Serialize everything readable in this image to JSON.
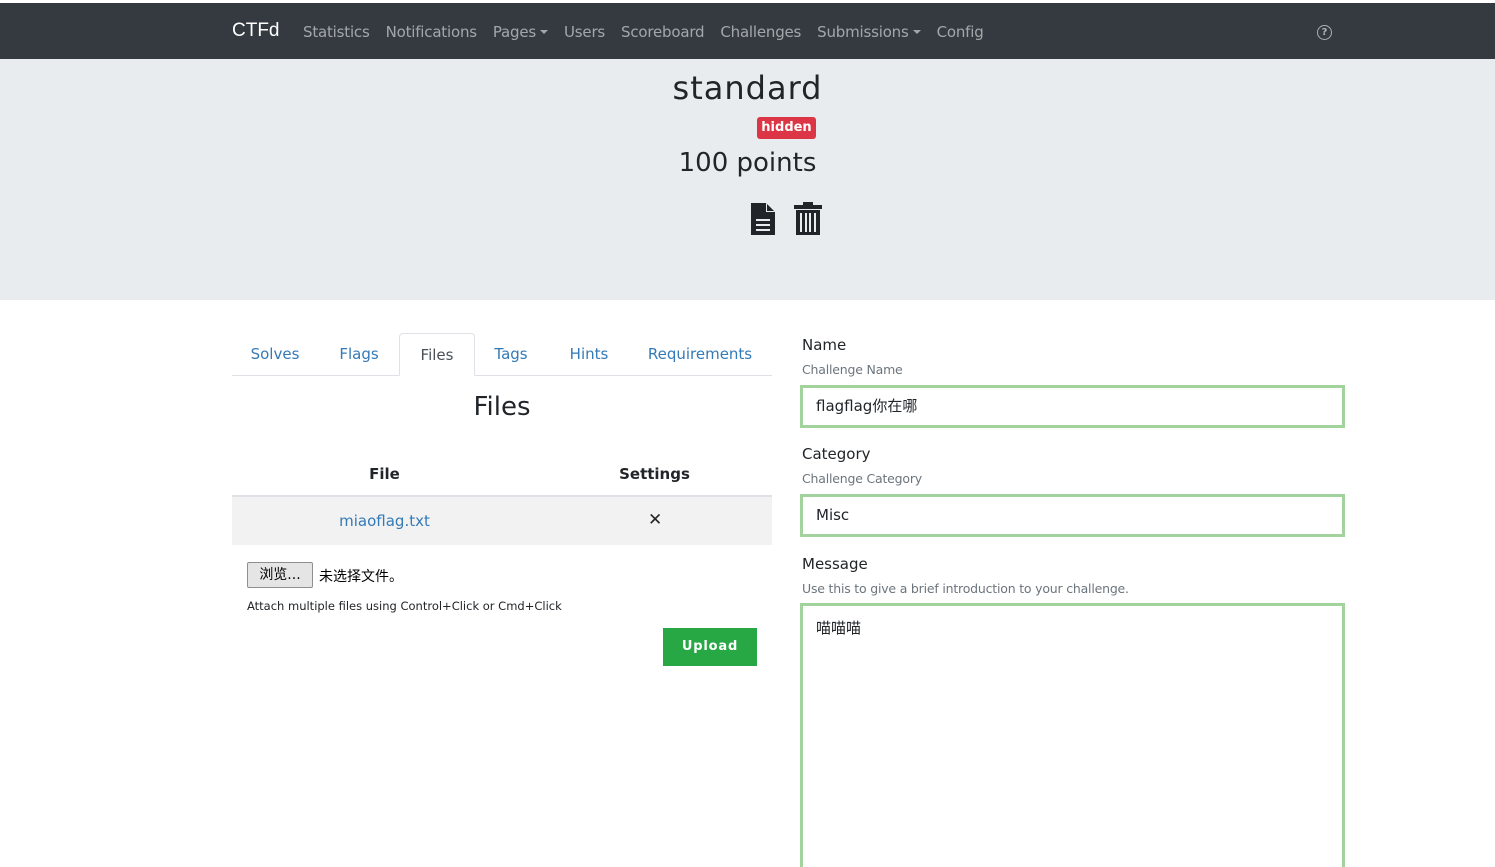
{
  "navbar": {
    "brand": "CTFd",
    "items": [
      {
        "label": "Statistics",
        "dropdown": false
      },
      {
        "label": "Notifications",
        "dropdown": false
      },
      {
        "label": "Pages",
        "dropdown": true
      },
      {
        "label": "Users",
        "dropdown": false
      },
      {
        "label": "Scoreboard",
        "dropdown": false
      },
      {
        "label": "Challenges",
        "dropdown": false
      },
      {
        "label": "Submissions",
        "dropdown": true
      },
      {
        "label": "Config",
        "dropdown": false
      }
    ],
    "help_icon": "question-circle-icon"
  },
  "challenge": {
    "title": "standard",
    "badge": "hidden",
    "points": "100 points",
    "icons": [
      "file-text-icon",
      "trash-icon"
    ]
  },
  "tabs": [
    {
      "label": "Solves",
      "active": false
    },
    {
      "label": "Flags",
      "active": false
    },
    {
      "label": "Files",
      "active": true
    },
    {
      "label": "Tags",
      "active": false
    },
    {
      "label": "Hints",
      "active": false
    },
    {
      "label": "Requirements",
      "active": false
    }
  ],
  "files": {
    "heading": "Files",
    "columns": [
      "File",
      "Settings"
    ],
    "rows": [
      {
        "file": "miaoflag.txt",
        "settings_icon": "times-icon"
      }
    ],
    "browse_label": "浏览...",
    "no_file_label": "未选择文件。",
    "help_text": "Attach multiple files using Control+Click or Cmd+Click",
    "upload_label": "Upload"
  },
  "form": {
    "name": {
      "label": "Name",
      "help": "Challenge Name",
      "value": "flagflag你在哪"
    },
    "category": {
      "label": "Category",
      "help": "Challenge Category",
      "value": "Misc"
    },
    "message": {
      "label": "Message",
      "help": "Use this to give a brief introduction to your challenge.",
      "value": "喵喵喵"
    }
  },
  "colors": {
    "navbar_bg": "#343a40",
    "jumbotron_bg": "#e9ecef",
    "badge_danger": "#dc3545",
    "link": "#337ab7",
    "upload_btn": "#28a745",
    "input_border_valid": "#a3d39c"
  }
}
